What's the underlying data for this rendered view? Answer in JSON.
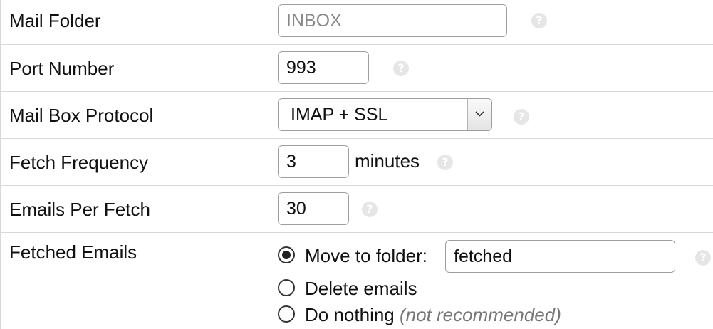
{
  "fields": {
    "mail_folder": {
      "label": "Mail Folder",
      "placeholder": "INBOX",
      "help_icon": "question-circle-icon"
    },
    "port_number": {
      "label": "Port Number",
      "value": "993",
      "help_icon": "question-circle-icon"
    },
    "mail_box_protocol": {
      "label": "Mail Box Protocol",
      "selected": "IMAP + SSL",
      "dropdown_icon": "chevron-down-icon",
      "help_icon": "question-circle-icon"
    },
    "fetch_frequency": {
      "label": "Fetch Frequency",
      "value": "3",
      "unit": "minutes",
      "help_icon": "question-circle-icon"
    },
    "emails_per_fetch": {
      "label": "Emails Per Fetch",
      "value": "30",
      "help_icon": "question-circle-icon"
    },
    "fetched_emails": {
      "label": "Fetched Emails",
      "options": [
        {
          "label": "Move to folder:",
          "checked": true,
          "folder_value": "fetched"
        },
        {
          "label": "Delete emails",
          "checked": false
        },
        {
          "label": "Do nothing",
          "note": "(not recommended)",
          "checked": false
        }
      ],
      "help_icon": "question-circle-icon"
    }
  },
  "colors": {
    "border": "#d8d8d8",
    "input_border": "#9e9e9e",
    "help_icon_bg": "#e6e6e6",
    "note_text": "#777777"
  }
}
